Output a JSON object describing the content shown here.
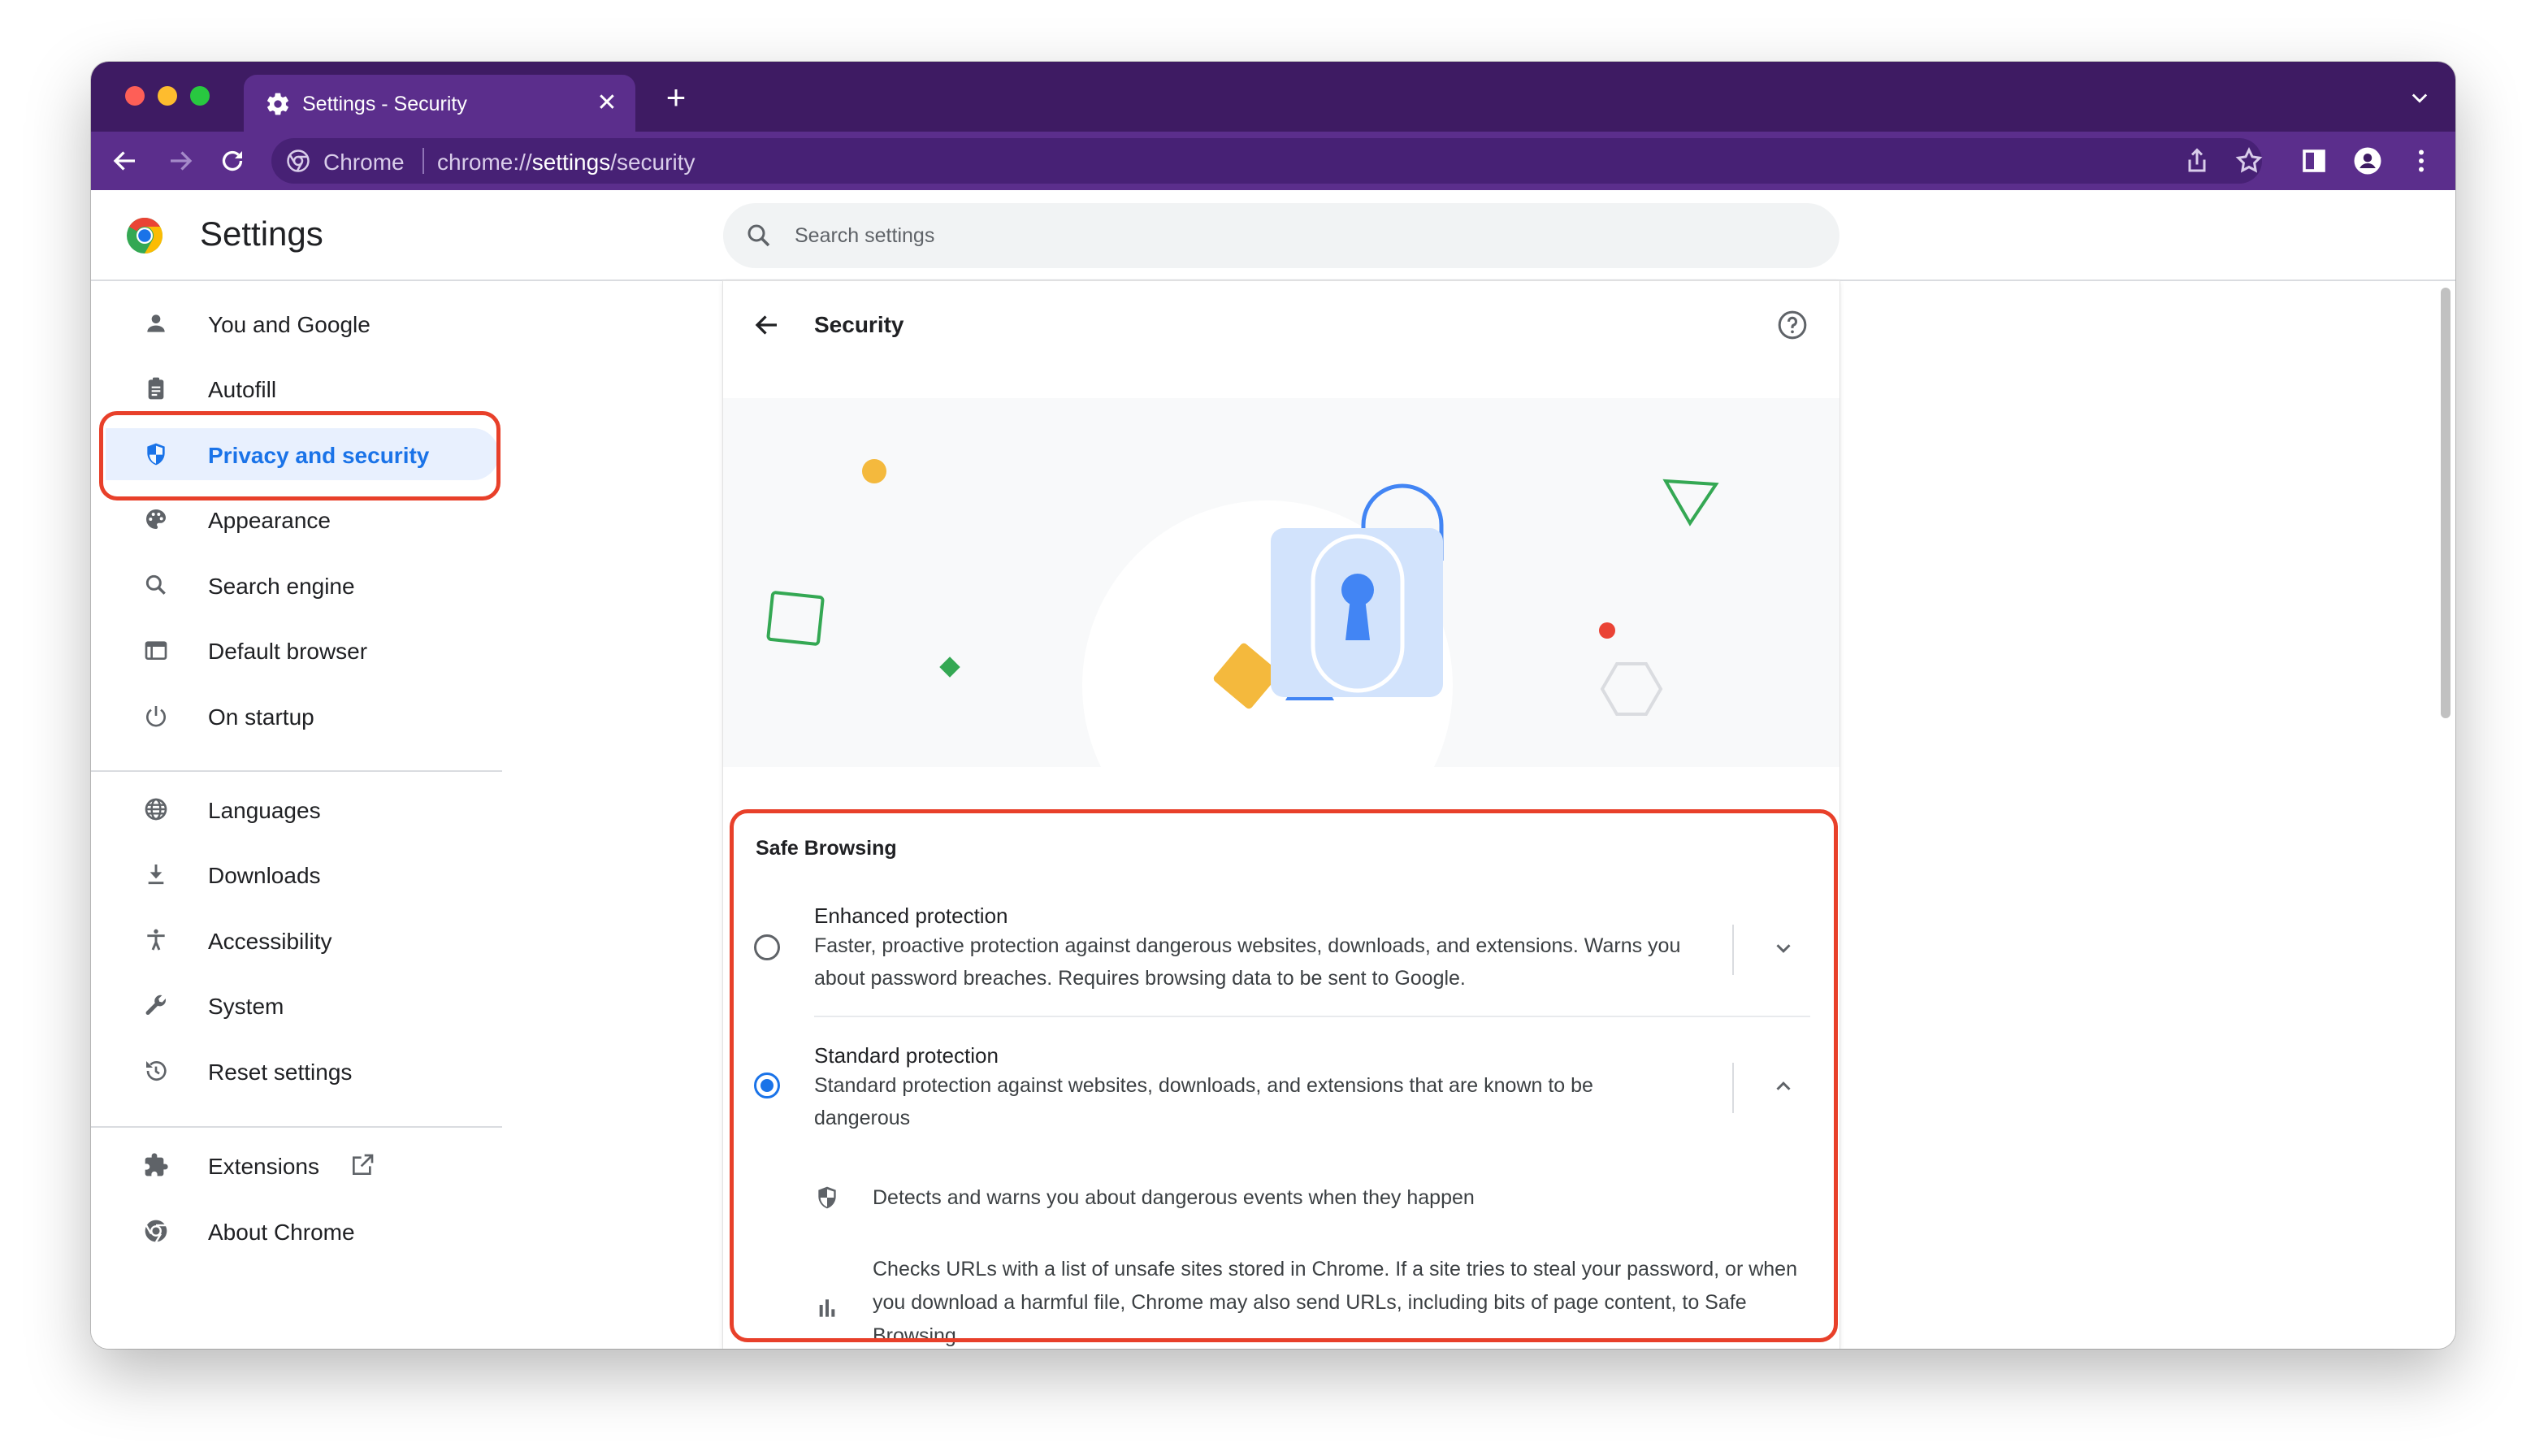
{
  "tab": {
    "title": "Settings - Security",
    "close_label": "✕"
  },
  "newtab_label": "+",
  "omnibox": {
    "scheme_label": "Chrome",
    "url_prefix": "chrome://",
    "url_host": "settings",
    "url_path": "/security"
  },
  "header": {
    "title": "Settings",
    "search_placeholder": "Search settings"
  },
  "sidebar": {
    "items": [
      {
        "label": "You and Google",
        "icon": "person-icon"
      },
      {
        "label": "Autofill",
        "icon": "clipboard-icon"
      },
      {
        "label": "Privacy and security",
        "icon": "shield-icon",
        "active": true
      },
      {
        "label": "Appearance",
        "icon": "palette-icon"
      },
      {
        "label": "Search engine",
        "icon": "search-icon"
      },
      {
        "label": "Default browser",
        "icon": "browser-window-icon"
      },
      {
        "label": "On startup",
        "icon": "power-icon"
      },
      {
        "label": "Languages",
        "icon": "globe-icon"
      },
      {
        "label": "Downloads",
        "icon": "download-icon"
      },
      {
        "label": "Accessibility",
        "icon": "accessibility-icon"
      },
      {
        "label": "System",
        "icon": "wrench-icon"
      },
      {
        "label": "Reset settings",
        "icon": "history-icon"
      },
      {
        "label": "Extensions",
        "icon": "puzzle-icon"
      },
      {
        "label": "About Chrome",
        "icon": "chrome-icon"
      }
    ]
  },
  "page": {
    "title": "Security",
    "safe_browsing": {
      "heading": "Safe Browsing",
      "options": [
        {
          "title": "Enhanced protection",
          "description": "Faster, proactive protection against dangerous websites, downloads, and extensions. Warns you about password breaches. Requires browsing data to be sent to Google.",
          "selected": false,
          "expanded": false
        },
        {
          "title": "Standard protection",
          "description": "Standard protection against websites, downloads, and extensions that are known to be dangerous",
          "selected": true,
          "expanded": true
        }
      ],
      "details": [
        {
          "icon": "shield-half-icon",
          "text": "Detects and warns you about dangerous events when they happen"
        },
        {
          "icon": "bar-chart-icon",
          "text": "Checks URLs with a list of unsafe sites stored in Chrome. If a site tries to steal your password, or when you download a harmful file, Chrome may also send URLs, including bits of page content, to Safe Browsing."
        }
      ]
    }
  },
  "colors": {
    "frame": "#3e1b63",
    "toolbar": "#5b2e8c",
    "accent": "#1a73e8",
    "highlight": "#e8402a",
    "active_nav_bg": "#e8f0fe"
  }
}
